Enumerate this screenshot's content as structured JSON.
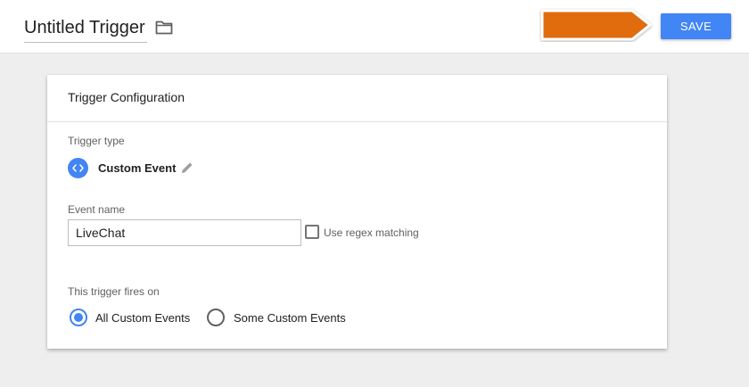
{
  "header": {
    "title": "Untitled Trigger",
    "save_label": "SAVE",
    "folder_icon": "folder-icon",
    "accent_color": "#4285f4",
    "pointer_arrow_color": "#e06c0f"
  },
  "card": {
    "title": "Trigger Configuration",
    "trigger_type_label": "Trigger type",
    "trigger_type_icon": "code-brackets-icon",
    "trigger_type_name": "Custom Event",
    "event_name_label": "Event name",
    "event_name_value": "LiveChat",
    "regex_label": "Use regex matching",
    "regex_checked": false,
    "fires_on_label": "This trigger fires on",
    "fires_on_options": [
      {
        "label": "All Custom Events",
        "selected": true
      },
      {
        "label": "Some Custom Events",
        "selected": false
      }
    ]
  }
}
